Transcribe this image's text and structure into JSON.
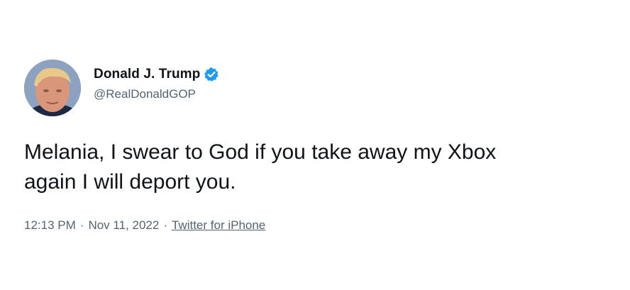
{
  "tweet": {
    "author": {
      "display_name": "Donald J. Trump",
      "handle": "@RealDonaldGOP",
      "verified_icon": "verified-badge-icon",
      "verified_color": "#1d9bf0"
    },
    "text_line1": "Melania, I swear to God if you take away my Xbox",
    "text_line2": "again I will deport you.",
    "time": "12:13 PM",
    "separator": "·",
    "date": "Nov 11, 2022",
    "source": "Twitter for iPhone"
  },
  "colors": {
    "text_primary": "#0f1419",
    "text_secondary": "#536471",
    "background": "#ffffff"
  }
}
